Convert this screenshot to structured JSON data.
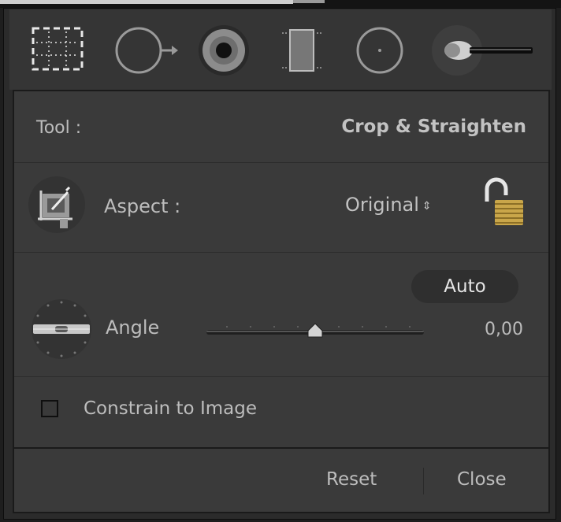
{
  "toolbar": {
    "tools": [
      {
        "name": "crop-overlay-icon",
        "active": true
      },
      {
        "name": "spot-removal-icon",
        "active": false
      },
      {
        "name": "red-eye-icon",
        "active": false
      },
      {
        "name": "graduated-filter-icon",
        "active": false
      },
      {
        "name": "radial-filter-icon",
        "active": false
      },
      {
        "name": "adjustment-brush-icon",
        "active": false
      }
    ]
  },
  "panel": {
    "tool_label": "Tool :",
    "tool_value": "Crop & Straighten",
    "aspect_label": "Aspect :",
    "aspect_value": "Original",
    "aspect_arrows": "⇕",
    "lock_state": "unlocked",
    "auto_label": "Auto",
    "angle_label": "Angle",
    "angle_value": "0,00",
    "angle_fraction": 0.5,
    "constrain_label": "Constrain to Image",
    "constrain_checked": false
  },
  "footer": {
    "reset_label": "Reset",
    "close_label": "Close"
  },
  "colors": {
    "background": "#3a3a3a",
    "toolbar": "#353535",
    "text": "#bdbdbd",
    "lock_gold": "#c9a64a"
  }
}
